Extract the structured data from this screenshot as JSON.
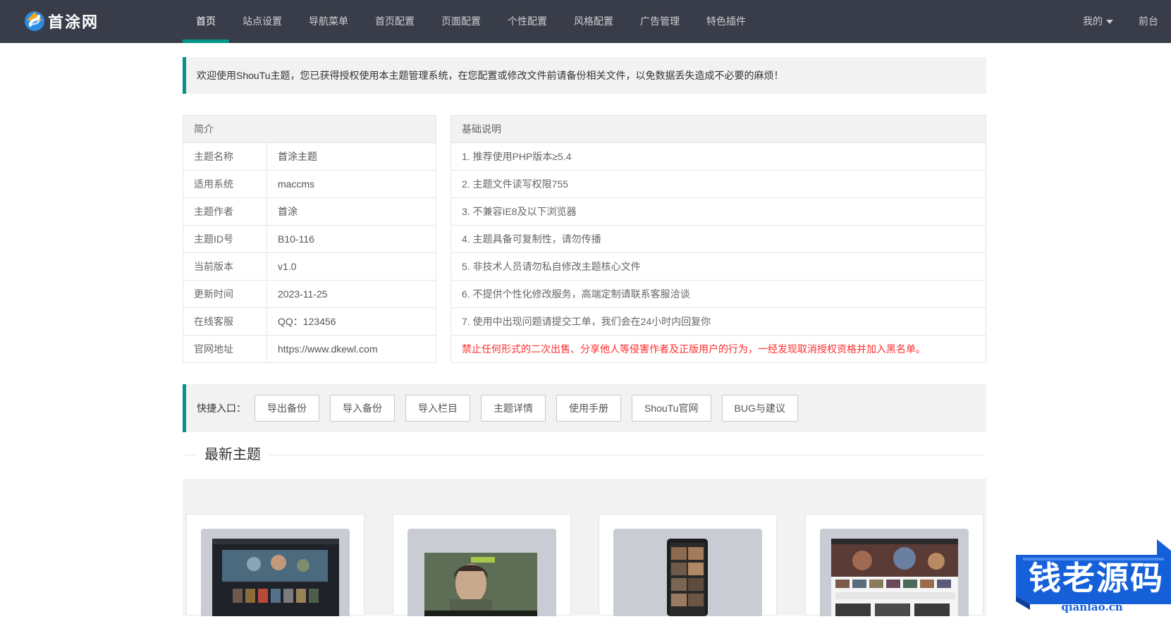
{
  "brand": {
    "name": "首涂网"
  },
  "nav": {
    "items": [
      {
        "label": "首页",
        "active": true
      },
      {
        "label": "站点设置"
      },
      {
        "label": "导航菜单"
      },
      {
        "label": "首页配置"
      },
      {
        "label": "页面配置"
      },
      {
        "label": "个性配置"
      },
      {
        "label": "风格配置"
      },
      {
        "label": "广告管理"
      },
      {
        "label": "特色插件"
      }
    ],
    "user_label": "我的",
    "front_label": "前台"
  },
  "notice": "欢迎使用ShouTu主题，您已获得授权使用本主题管理系统，在您配置或修改文件前请备份相关文件，以免数据丢失造成不必要的麻烦！",
  "intro": {
    "title": "简介",
    "rows": [
      {
        "key": "主题名称",
        "value": "首涂主题"
      },
      {
        "key": "适用系统",
        "value": "maccms"
      },
      {
        "key": "主题作者",
        "value": "首涂"
      },
      {
        "key": "主题ID号",
        "value": "B10-116"
      },
      {
        "key": "当前版本",
        "value": "v1.0"
      },
      {
        "key": "更新时间",
        "value": "2023-11-25"
      },
      {
        "key": "在线客服",
        "value": "QQ：123456"
      },
      {
        "key": "官网地址",
        "value": "https://www.dkewl.com"
      }
    ]
  },
  "basics": {
    "title": "基础说明",
    "rows": [
      "1. 推荐使用PHP版本≥5.4",
      "2. 主题文件读写权限755",
      "3. 不兼容IE8及以下浏览器",
      "4. 主题具备可复制性，请勿传播",
      "5. 非技术人员请勿私自修改主题核心文件",
      "6. 不提供个性化修改服务，高端定制请联系客服洽谈",
      "7. 使用中出现问题请提交工单，我们会在24小时内回复你"
    ],
    "warning": "禁止任何形式的二次出售、分享他人等侵害作者及正版用户的行为，一经发现取消授权资格并加入黑名单。"
  },
  "quick": {
    "label": "快捷入口：",
    "buttons": [
      "导出备份",
      "导入备份",
      "导入栏目",
      "主题详情",
      "使用手册",
      "ShouTu官网",
      "BUG与建议"
    ]
  },
  "latest": {
    "title": "最新主题"
  },
  "watermark": {
    "text": "钱老源码",
    "domain": "qianlao.cn"
  },
  "colors": {
    "topbar": "#393d49",
    "accent": "#009688",
    "warning": "#ff2d2d",
    "watermark": "#1560d8"
  }
}
